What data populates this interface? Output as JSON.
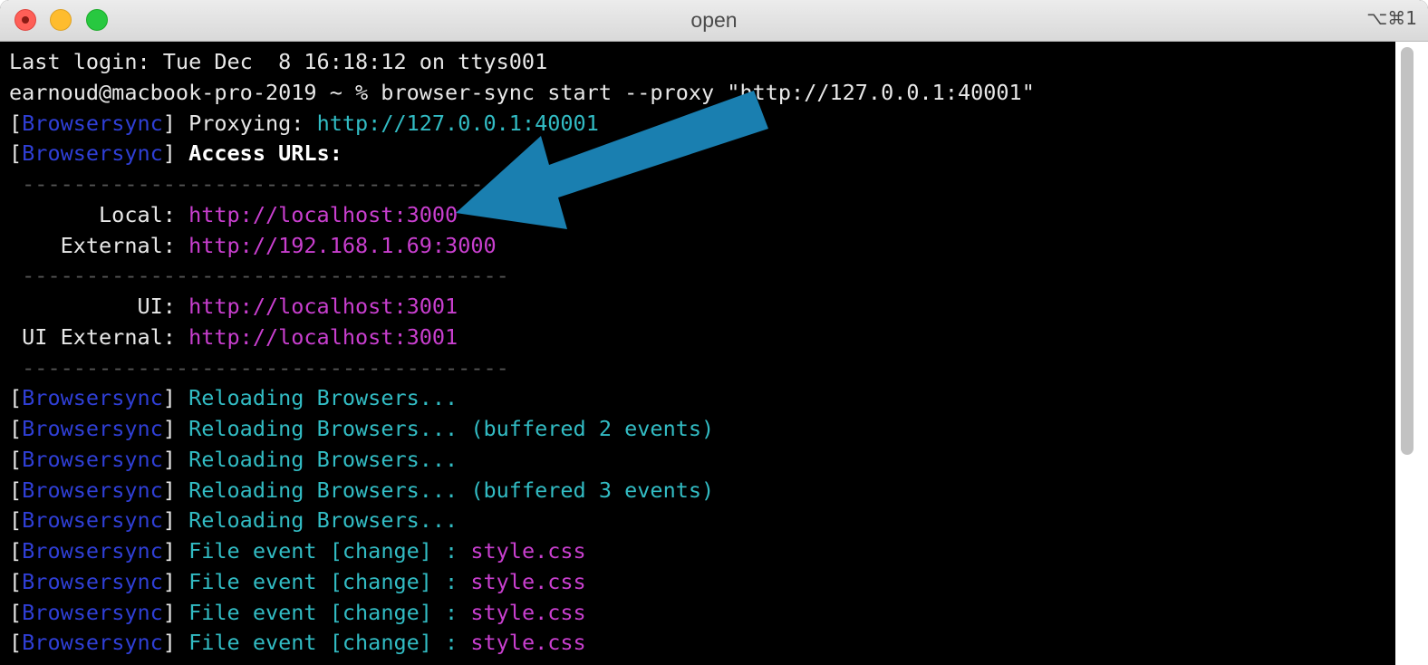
{
  "window": {
    "title": "open",
    "shortcut": "⌥⌘1"
  },
  "terminal": {
    "lines": [
      [
        {
          "text": "Last login: Tue Dec  8 16:18:12 on ttys001",
          "color": "white"
        }
      ],
      [
        {
          "text": "earnoud@macbook-pro-2019 ~ % browser-sync start --proxy \"http://127.0.0.1:40001\"",
          "color": "white"
        }
      ],
      [
        {
          "text": "[",
          "color": "white"
        },
        {
          "text": "Browsersync",
          "color": "blue"
        },
        {
          "text": "] ",
          "color": "white"
        },
        {
          "text": "Proxying: ",
          "color": "white"
        },
        {
          "text": "http://127.0.0.1:40001",
          "color": "cyan"
        }
      ],
      [
        {
          "text": "[",
          "color": "white"
        },
        {
          "text": "Browsersync",
          "color": "blue"
        },
        {
          "text": "] ",
          "color": "white"
        },
        {
          "text": "Access URLs:",
          "color": "bold"
        }
      ],
      [
        {
          "text": " --------------------------------------",
          "color": "gray"
        }
      ],
      [
        {
          "text": "       Local: ",
          "color": "white"
        },
        {
          "text": "http://localhost:3000",
          "color": "magenta"
        }
      ],
      [
        {
          "text": "    External: ",
          "color": "white"
        },
        {
          "text": "http://192.168.1.69:3000",
          "color": "magenta"
        }
      ],
      [
        {
          "text": " --------------------------------------",
          "color": "gray"
        }
      ],
      [
        {
          "text": "          UI: ",
          "color": "white"
        },
        {
          "text": "http://localhost:3001",
          "color": "magenta"
        }
      ],
      [
        {
          "text": " UI External: ",
          "color": "white"
        },
        {
          "text": "http://localhost:3001",
          "color": "magenta"
        }
      ],
      [
        {
          "text": " --------------------------------------",
          "color": "gray"
        }
      ],
      [
        {
          "text": "[",
          "color": "white"
        },
        {
          "text": "Browsersync",
          "color": "blue"
        },
        {
          "text": "] ",
          "color": "white"
        },
        {
          "text": "Reloading Browsers...",
          "color": "cyan"
        }
      ],
      [
        {
          "text": "[",
          "color": "white"
        },
        {
          "text": "Browsersync",
          "color": "blue"
        },
        {
          "text": "] ",
          "color": "white"
        },
        {
          "text": "Reloading Browsers... (buffered 2 events)",
          "color": "cyan"
        }
      ],
      [
        {
          "text": "[",
          "color": "white"
        },
        {
          "text": "Browsersync",
          "color": "blue"
        },
        {
          "text": "] ",
          "color": "white"
        },
        {
          "text": "Reloading Browsers...",
          "color": "cyan"
        }
      ],
      [
        {
          "text": "[",
          "color": "white"
        },
        {
          "text": "Browsersync",
          "color": "blue"
        },
        {
          "text": "] ",
          "color": "white"
        },
        {
          "text": "Reloading Browsers... (buffered 3 events)",
          "color": "cyan"
        }
      ],
      [
        {
          "text": "[",
          "color": "white"
        },
        {
          "text": "Browsersync",
          "color": "blue"
        },
        {
          "text": "] ",
          "color": "white"
        },
        {
          "text": "Reloading Browsers...",
          "color": "cyan"
        }
      ],
      [
        {
          "text": "[",
          "color": "white"
        },
        {
          "text": "Browsersync",
          "color": "blue"
        },
        {
          "text": "] ",
          "color": "white"
        },
        {
          "text": "File event [change] : ",
          "color": "cyan"
        },
        {
          "text": "style.css",
          "color": "magenta"
        }
      ],
      [
        {
          "text": "[",
          "color": "white"
        },
        {
          "text": "Browsersync",
          "color": "blue"
        },
        {
          "text": "] ",
          "color": "white"
        },
        {
          "text": "File event [change] : ",
          "color": "cyan"
        },
        {
          "text": "style.css",
          "color": "magenta"
        }
      ],
      [
        {
          "text": "[",
          "color": "white"
        },
        {
          "text": "Browsersync",
          "color": "blue"
        },
        {
          "text": "] ",
          "color": "white"
        },
        {
          "text": "File event [change] : ",
          "color": "cyan"
        },
        {
          "text": "style.css",
          "color": "magenta"
        }
      ],
      [
        {
          "text": "[",
          "color": "white"
        },
        {
          "text": "Browsersync",
          "color": "blue"
        },
        {
          "text": "] ",
          "color": "white"
        },
        {
          "text": "File event [change] : ",
          "color": "cyan"
        },
        {
          "text": "style.css",
          "color": "magenta"
        }
      ]
    ]
  },
  "colors": {
    "terminal_background": "#000000",
    "browsersync_tag": "#2f3fd6",
    "cyan_text": "#32bcc4",
    "magenta_url": "#c93fcf",
    "annotation_arrow": "#1a7fb0"
  },
  "annotation": {
    "icon": "arrow-icon"
  }
}
